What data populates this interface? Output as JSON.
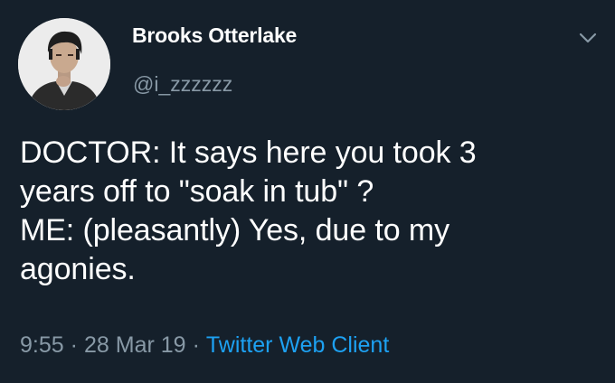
{
  "user": {
    "display_name": "Brooks Otterlake",
    "handle": "@i_zzzzzz"
  },
  "tweet": {
    "lines": [
      "DOCTOR: It says here you took 3",
      "years off to \"soak in tub\" ?",
      "ME: (pleasantly) Yes, due to my",
      "agonies."
    ]
  },
  "meta": {
    "time": "9:55",
    "separator": "·",
    "date": "28 Mar 19",
    "source": "Twitter Web Client"
  },
  "icons": {
    "menu": "chevron-down-icon",
    "avatar": "profile-photo"
  },
  "colors": {
    "background": "#15202b",
    "primary_text": "#ffffff",
    "secondary_text": "#8899a6",
    "link": "#1da1f2"
  }
}
